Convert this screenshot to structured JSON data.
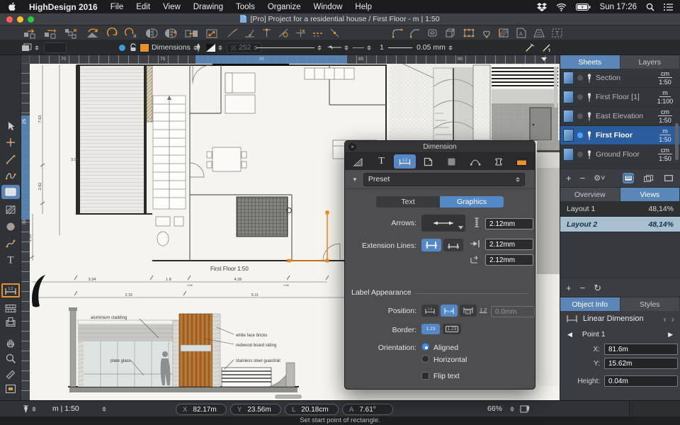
{
  "menu_bar": {
    "app_name": "HighDesign 2016",
    "menus": [
      "File",
      "Edit",
      "View",
      "Drawing",
      "Tools",
      "Organize",
      "Window",
      "Help"
    ],
    "clock": "Sun 17:26"
  },
  "title_bar": {
    "title": "[Pro] Project for a residential house / First Floor - m | 1:50"
  },
  "options_bar": {
    "layer_name": "Dimensions",
    "pen_opacity": "252",
    "line_scale": "1",
    "line_weight": "0.05 mm"
  },
  "canvas": {
    "h_ruler": [
      "70",
      "75",
      "80",
      "85",
      "90"
    ],
    "v_ruler": [
      "25",
      "30"
    ],
    "plan": {
      "title": "First Floor 1:50",
      "dims": {
        "left1": "7.63",
        "left2": "2.62",
        "left3": "1.10",
        "inner": "3.08",
        "b1": "3.34",
        "b2": "1.8",
        "b3": "4.39",
        "b4": "0.38",
        "b5": "0.38",
        "c1": "2.16",
        "c2": "5.11"
      }
    },
    "elevation": {
      "label_cladding": "aluminium cladding",
      "label_bricks": "white face bricks",
      "label_siding": "redwood board siding",
      "label_guardrail": "stainless steel guardrail",
      "label_glass": "plate glass"
    }
  },
  "dialog": {
    "title": "Dimension",
    "preset": "Preset",
    "seg": [
      "Text",
      "Graphics"
    ],
    "arrows_label": "Arrows:",
    "arrow_size": "2.12mm",
    "ext_label": "Extension Lines:",
    "ext_size1": "2.12mm",
    "ext_size2": "2.12mm",
    "section2": "Label Appearance",
    "position_label": "Position:",
    "offset_value": "0.0mm",
    "border_label": "Border:",
    "border1": "1.23",
    "border2": "1.23",
    "orientation_label": "Orientation:",
    "aligned": "Aligned",
    "horizontal": "Horizontal",
    "flip": "Flip text",
    "pos_glyph": "1.2"
  },
  "sidebar": {
    "tab_sheets": "Sheets",
    "tab_layers": "Layers",
    "sheets": [
      {
        "name": "Section",
        "unit": "cm",
        "scale": "1:50"
      },
      {
        "name": "First Floor [1]",
        "unit": "m",
        "scale": "1:100"
      },
      {
        "name": "East Elevation",
        "unit": "cm",
        "scale": "1:50"
      },
      {
        "name": "First Floor",
        "unit": "m",
        "scale": "1:50"
      },
      {
        "name": "Ground Floor",
        "unit": "cm",
        "scale": "1:50"
      }
    ],
    "tab_overview": "Overview",
    "tab_views": "Views",
    "layouts": [
      {
        "name": "Layout 1",
        "zoom": "48,14%"
      },
      {
        "name": "Layout 2",
        "zoom": "48,14%"
      }
    ],
    "tab_object": "Object Info",
    "tab_styles": "Styles",
    "object_type": "Linear Dimension",
    "point": "Point 1",
    "x_label": "X:",
    "x_value": "81.6m",
    "y_label": "Y:",
    "y_value": "15.62m",
    "h_label": "Height:",
    "h_value": "0.04m"
  },
  "status_bar": {
    "scale": "m | 1:50",
    "x_label": "X",
    "x": "82.17m",
    "y_label": "Y",
    "y": "23.56m",
    "l_label": "L",
    "l": "20.18cm",
    "a_label": "A",
    "a": "7.61°",
    "zoom": "66%",
    "message": "Set start point of rectangle."
  },
  "glyphs": {
    "text_tool": "T",
    "gear": "⚙",
    "refresh": "↻",
    "plus": "+",
    "minus": "−",
    "prev": "‹",
    "next": "›",
    "left_tri": "◀",
    "right_tri": "▶",
    "disclosure": "▼",
    "close": "×"
  },
  "colors": {
    "accent_blue": "#5b87b8",
    "dialog_blue": "#5588c7",
    "selection_orange": "#f08c1e",
    "layer_orange": "#e8922c",
    "sheet_selected": "#2a5c9e"
  }
}
